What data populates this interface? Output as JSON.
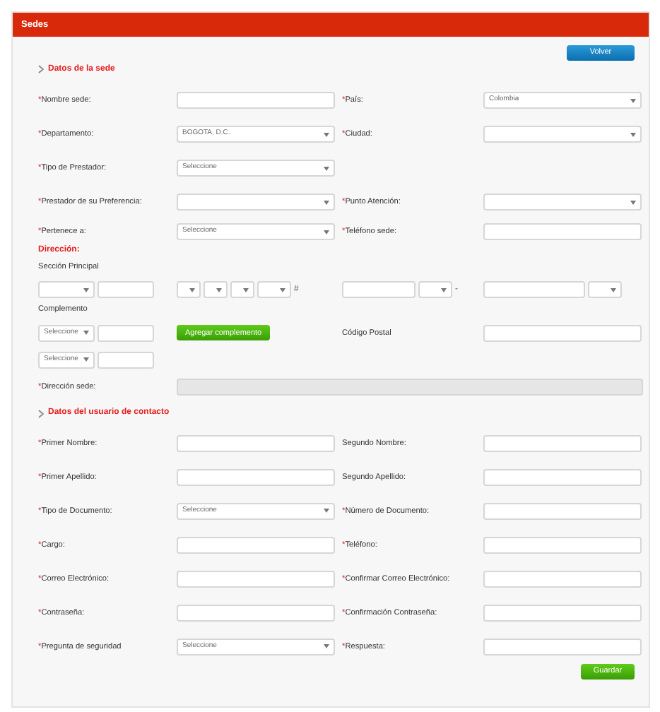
{
  "panel": {
    "title": "Sedes"
  },
  "back_button": "Volver",
  "site_section": {
    "title": "Datos de la sede",
    "rows": [
      [
        {
          "asterisk": "*",
          "label": "Nombre sede:",
          "kind": "text"
        },
        {
          "asterisk": "*",
          "label": "País:",
          "kind": "select",
          "value": "Colombia"
        }
      ],
      [
        {
          "asterisk": "*",
          "label": "Departamento:",
          "kind": "select",
          "value": "BOGOTA, D.C."
        },
        {
          "asterisk": "*",
          "label": "Ciudad:",
          "kind": "select"
        }
      ],
      [
        {
          "asterisk": "*",
          "label": "Tipo de Prestador:",
          "kind": "select",
          "value": "Seleccione"
        }
      ],
      [
        {
          "asterisk": "*",
          "label": "Prestador de su Preferencia:",
          "kind": "select"
        },
        {
          "asterisk": "*",
          "label": "Punto Atención:",
          "kind": "select"
        }
      ],
      [
        {
          "asterisk": "*",
          "label": "Pertenece a:",
          "kind": "select",
          "value": "Seleccione"
        },
        {
          "asterisk": "*",
          "label": "Teléfono sede:",
          "kind": "text"
        }
      ]
    ]
  },
  "address": {
    "title": "Dirección:",
    "main_label": "Sección Principal",
    "main_parts": [
      [
        {
          "kind": "select"
        },
        {
          "kind": "text"
        }
      ],
      [
        {
          "kind": "select"
        },
        {
          "kind": "select"
        },
        {
          "kind": "select"
        },
        {
          "kind": "select"
        },
        {
          "kind": "symbol",
          "text": "#"
        }
      ],
      [
        {
          "kind": "text"
        },
        {
          "kind": "select"
        },
        {
          "kind": "symbol",
          "text": "-"
        }
      ],
      [
        {
          "kind": "text"
        },
        {
          "kind": "select"
        }
      ]
    ],
    "complement_label": "Complemento",
    "complements": [
      {
        "select": "Seleccione"
      },
      {
        "select": "Seleccione"
      }
    ],
    "add_button": "Agregar complemento",
    "postal_label": "Código Postal",
    "full_address": {
      "asterisk": "*",
      "label": "Dirección sede:",
      "disabled": true
    }
  },
  "contact_section": {
    "title": "Datos del usuario de contacto",
    "rows": [
      [
        {
          "asterisk": "*",
          "label": "Primer Nombre:",
          "kind": "text"
        },
        {
          "label": "Segundo Nombre:",
          "kind": "text"
        }
      ],
      [
        {
          "asterisk": "*",
          "label": "Primer Apellido:",
          "kind": "text"
        },
        {
          "label": "Segundo Apellido:",
          "kind": "text"
        }
      ],
      [
        {
          "asterisk": "*",
          "label": "Tipo de Documento:",
          "kind": "select",
          "value": "Seleccione"
        },
        {
          "asterisk": "*",
          "label": "Número de Documento:",
          "kind": "text"
        }
      ],
      [
        {
          "asterisk": "*",
          "label": "Cargo:",
          "kind": "text"
        },
        {
          "asterisk": "*",
          "label": "Teléfono:",
          "kind": "text"
        }
      ],
      [
        {
          "asterisk": "*",
          "label": "Correo Electrónico:",
          "kind": "text"
        },
        {
          "asterisk": "*",
          "label": "Confirmar Correo Electrónico:",
          "kind": "text"
        }
      ],
      [
        {
          "asterisk": "*",
          "label": "Contraseña:",
          "kind": "text"
        },
        {
          "asterisk": "*",
          "label": "Confirmación Contraseña:",
          "kind": "text"
        }
      ],
      [
        {
          "asterisk": "*",
          "label": "Pregunta de seguridad",
          "kind": "select",
          "value": "Seleccione"
        },
        {
          "asterisk": "*",
          "label": "Respuesta:",
          "kind": "text"
        }
      ]
    ]
  },
  "save_button": "Guardar"
}
